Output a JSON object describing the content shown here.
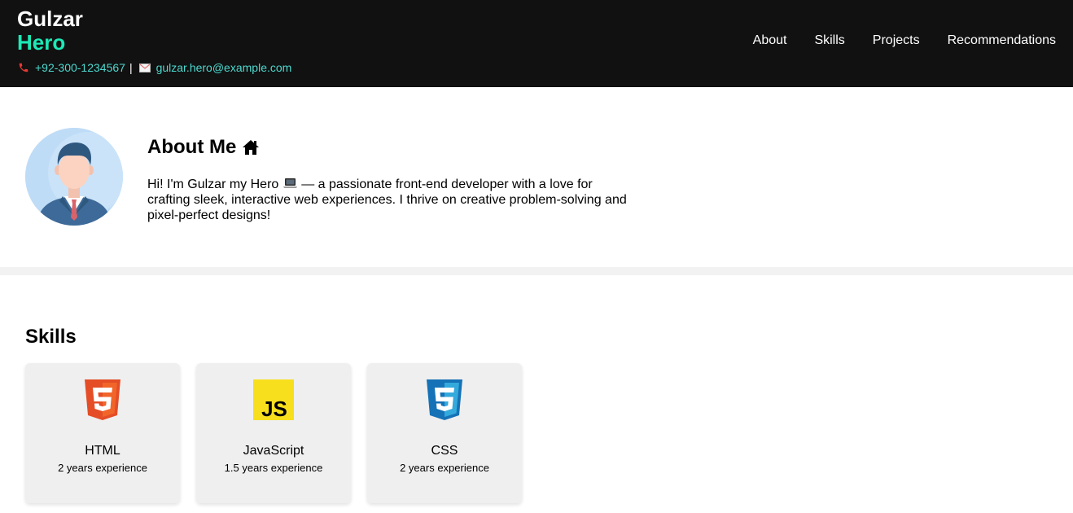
{
  "header": {
    "first_name": "Gulzar",
    "last_name": "Hero",
    "phone": "+92-300-1234567",
    "separator": "|",
    "email": "gulzar.hero@example.com",
    "nav": [
      {
        "label": "About"
      },
      {
        "label": "Skills"
      },
      {
        "label": "Projects"
      },
      {
        "label": "Recommendations"
      }
    ]
  },
  "about": {
    "title": "About Me",
    "text_before": "Hi! I'm Gulzar my Hero ",
    "text_after": " — a passionate front-end developer with a love for crafting sleek, interactive web experiences. I thrive on creative problem-solving and pixel-perfect designs!"
  },
  "skills": {
    "title": "Skills",
    "items": [
      {
        "name": "HTML",
        "experience": "2 years experience",
        "icon": "html5-icon"
      },
      {
        "name": "JavaScript",
        "experience": "1.5 years experience",
        "icon": "javascript-icon"
      },
      {
        "name": "CSS",
        "experience": "2 years experience",
        "icon": "css3-icon"
      }
    ]
  },
  "colors": {
    "header_bg": "#111111",
    "accent": "#1de9b6",
    "contact_text": "#4dd9cf"
  }
}
